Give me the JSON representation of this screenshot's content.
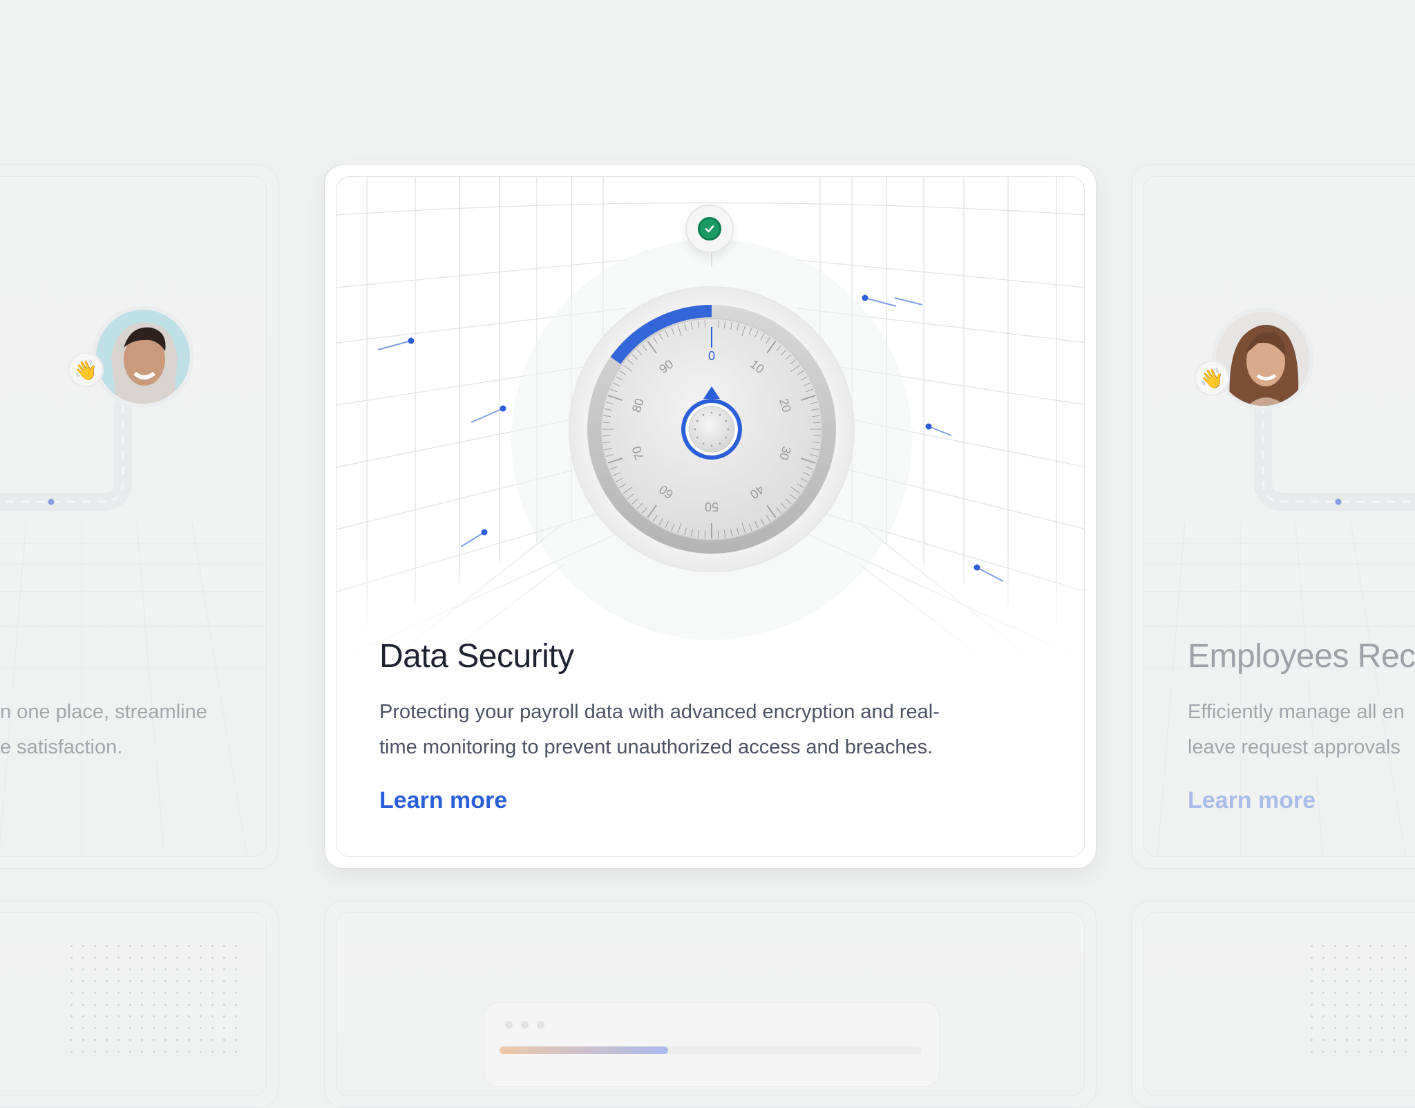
{
  "main_card": {
    "title": "Data Security",
    "description_line1": "Protecting your payroll data with advanced encryption and real-",
    "description_line2": "time monitoring to prevent unauthorized access and breaches.",
    "link_label": "Learn more",
    "dial_numbers": [
      "0",
      "10",
      "20",
      "30",
      "40",
      "50",
      "60",
      "70",
      "80",
      "90"
    ],
    "status_icon": "check-circle-icon"
  },
  "left_card": {
    "description_line1": "n one place, streamline",
    "description_line2": "e satisfaction.",
    "reaction_emoji": "👋"
  },
  "right_card": {
    "title": "Employees Rec",
    "description_line1": "Efficiently manage all en",
    "description_line2": "leave request approvals",
    "link_label": "Learn more",
    "reaction_emoji": "👋"
  },
  "colors": {
    "accent": "#2b5fd9",
    "accent_faded": "#a8bce9",
    "title": "#1f2230",
    "body_text": "#4b5262",
    "faded_text": "#a3a6ab",
    "success": "#1a9a64"
  }
}
